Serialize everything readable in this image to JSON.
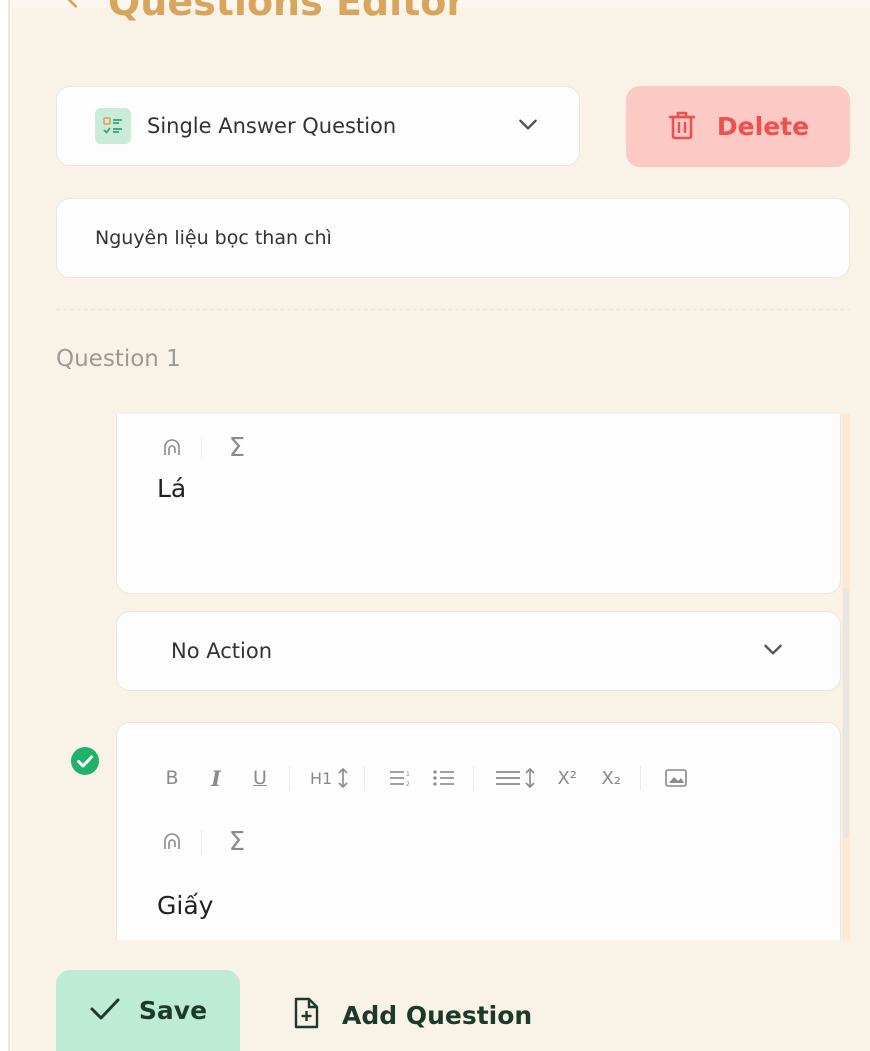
{
  "header": {
    "title": "Questions Editor"
  },
  "question_type": {
    "label": "Single Answer Question"
  },
  "delete_button": {
    "label": "Delete"
  },
  "group_name": {
    "value": "Nguyên liệu bọc than chì"
  },
  "question": {
    "label": "Question 1",
    "answers": [
      {
        "text": "Lá"
      },
      {
        "text": "Giấy",
        "correct": true
      }
    ],
    "action": {
      "label": "No Action"
    }
  },
  "toolbar": {
    "bold": "B",
    "italic": "I",
    "underline": "U",
    "heading": "H1",
    "superscript": "X²",
    "subscript": "X₂",
    "sigma": "Σ"
  },
  "footer": {
    "save_label": "Save",
    "add_question_label": "Add Question"
  },
  "colors": {
    "background": "#f9f3e7",
    "title": "#d9a45b",
    "delete_bg": "#fcc9c4",
    "delete_text": "#ee4f4f",
    "save_bg": "#bdebd3",
    "correct": "#20b26b"
  }
}
